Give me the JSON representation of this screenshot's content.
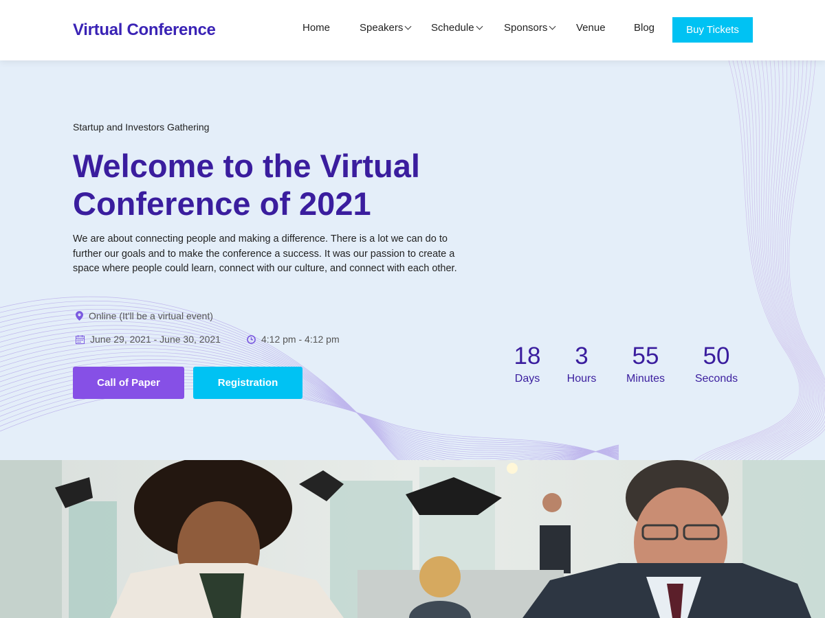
{
  "header": {
    "logo": "Virtual Conference",
    "nav": [
      {
        "label": "Home",
        "dropdown": false
      },
      {
        "label": "Speakers",
        "dropdown": true
      },
      {
        "label": "Schedule",
        "dropdown": true
      },
      {
        "label": "Sponsors",
        "dropdown": true
      },
      {
        "label": "Venue",
        "dropdown": false
      },
      {
        "label": "Blog",
        "dropdown": false
      }
    ],
    "buy_label": "Buy Tickets"
  },
  "hero": {
    "subtitle": "Startup and Investors Gathering",
    "headline": "Welcome to the Virtual Conference of 2021",
    "description": "We are about connecting people and making a difference. There is a lot we can do to further our goals and to make the conference a success. It was our passion to create a space where people could learn, connect with our culture, and connect with each other.",
    "location": "Online (It'll be a virtual event)",
    "dates": "June 29, 2021 - June 30, 2021",
    "time": "4:12 pm - 4:12 pm",
    "call_of_paper_label": "Call of Paper",
    "registration_label": "Registration"
  },
  "countdown": [
    {
      "value": "18",
      "label": "Days"
    },
    {
      "value": "3",
      "label": "Hours"
    },
    {
      "value": "55",
      "label": "Minutes"
    },
    {
      "value": "50",
      "label": "Seconds"
    }
  ],
  "colors": {
    "brand": "#3a1d9e",
    "accent_cyan": "#00c2f3",
    "accent_purple": "#8650e6",
    "hero_bg": "#e4eef9"
  },
  "icons": {
    "location": "map-pin-icon",
    "date": "calendar-icon",
    "time": "clock-icon"
  }
}
